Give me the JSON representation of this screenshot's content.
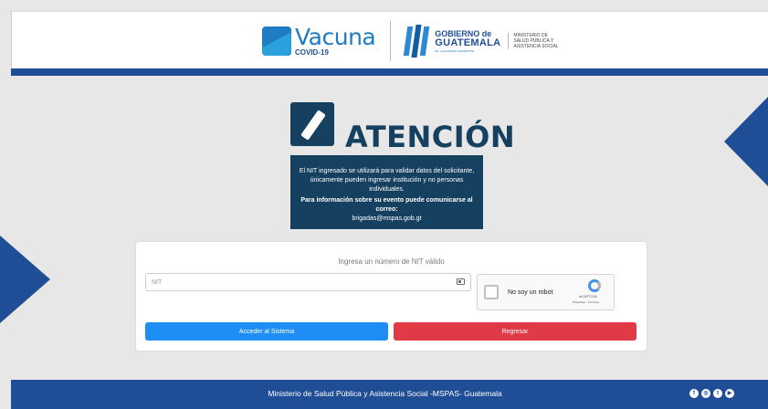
{
  "header": {
    "vacuna_title": "Vacuna",
    "vacuna_sub": "COVID-19",
    "gobierno_top": "GOBIERNO de",
    "gobierno_main": "GUATEMALA",
    "gobierno_tiny": "DR. ALEJANDRO GIAMMATTEI",
    "ministerio": "MINISTERIO DE SALUD PÚBLICA Y ASISTENCIA SOCIAL"
  },
  "attention": {
    "title": "ATENCIÓN",
    "line1": "El NIT ingresado se utilizará para validar datos del solicitante,",
    "line2": "únicamente pueden ingresar institución y no personas individuales.",
    "line3": "Para información sobre su evento puede comunicarse al correo:",
    "line4": "brigadas@mspas.gob.gt"
  },
  "form": {
    "title": "Ingresa un número de NIT válido",
    "nit_placeholder": "NIT",
    "nit_value": "",
    "recaptcha_label": "No soy un robot",
    "recaptcha_brand": "reCAPTCHA",
    "recaptcha_links": "Privacidad - Términos",
    "login_button": "Acceder al Sistema",
    "back_button": "Regresar"
  },
  "footer": {
    "text": "Ministerio de Salud Pública y Asistencia Social -MSPAS- Guatemala",
    "social": [
      {
        "icon": "facebook-icon",
        "glyph": "f"
      },
      {
        "icon": "instagram-icon",
        "glyph": "◎"
      },
      {
        "icon": "twitter-icon",
        "glyph": "t"
      },
      {
        "icon": "youtube-icon",
        "glyph": "▶"
      }
    ]
  },
  "colors": {
    "brand_blue": "#1f4e97",
    "notice_dark": "#16405f",
    "primary_button": "#1e8ef5",
    "danger_button": "#e13a47"
  }
}
